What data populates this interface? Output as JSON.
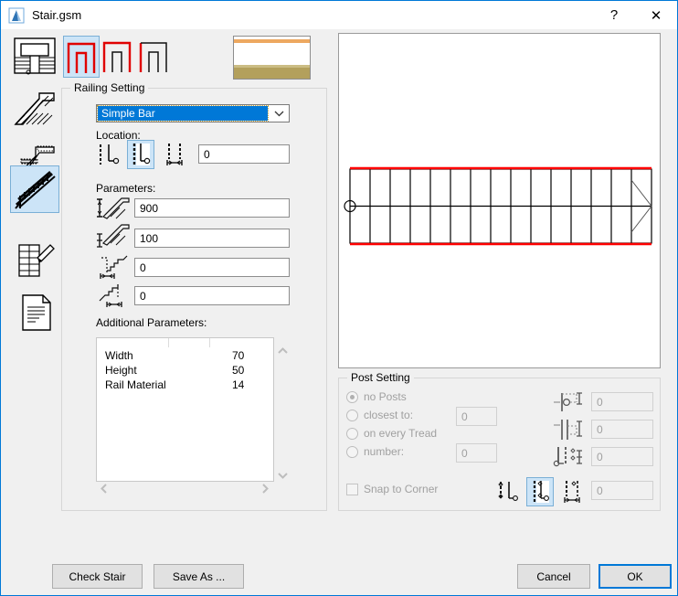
{
  "window": {
    "title": "Stair.gsm",
    "help_label": "?",
    "close_label": "✕"
  },
  "sidebar": {
    "items": [
      {
        "name": "stair-plan",
        "selected": false
      },
      {
        "name": "stair-section",
        "selected": false
      },
      {
        "name": "stair-structure",
        "selected": false
      },
      {
        "name": "stair-railing",
        "selected": true
      },
      {
        "name": "stair-symbol",
        "selected": false
      },
      {
        "name": "stair-listing",
        "selected": false
      }
    ]
  },
  "toolbar": {
    "shapes": [
      {
        "name": "railing-both-sides",
        "selected": true
      },
      {
        "name": "railing-left-side",
        "selected": false
      },
      {
        "name": "railing-right-side",
        "selected": false
      }
    ]
  },
  "railing_setting": {
    "group_title": "Railing Setting",
    "type_value": "Simple Bar",
    "location_label": "Location:",
    "location_buttons": [
      {
        "name": "location-outer",
        "selected": false
      },
      {
        "name": "location-inner",
        "selected": true
      },
      {
        "name": "location-offset",
        "selected": false
      }
    ],
    "location_value": "0",
    "parameters_label": "Parameters:",
    "parameters": [
      {
        "icon": "railing-height-icon",
        "value": "900"
      },
      {
        "icon": "railing-rail-height-icon",
        "value": "100"
      },
      {
        "icon": "railing-start-offset-icon",
        "value": "0"
      },
      {
        "icon": "railing-end-offset-icon",
        "value": "0"
      }
    ],
    "additional_label": "Additional Parameters:",
    "additional_rows": [
      {
        "name": "Width",
        "value": "70"
      },
      {
        "name": "Height",
        "value": "50"
      },
      {
        "name": "Rail Material",
        "value": "14"
      }
    ],
    "scroll_up": "⌃",
    "scroll_down": "⌄",
    "scroll_left": "‹",
    "scroll_right": "›"
  },
  "post_setting": {
    "group_title": "Post Setting",
    "radios": [
      {
        "label": "no Posts",
        "selected": true,
        "has_field": false,
        "value": ""
      },
      {
        "label": "closest to:",
        "selected": false,
        "has_field": true,
        "value": "0"
      },
      {
        "label": "on every Tread",
        "selected": false,
        "has_field": false,
        "value": ""
      },
      {
        "label": "number:",
        "selected": false,
        "has_field": true,
        "value": "0"
      }
    ],
    "snap_label": "Snap to Corner",
    "snap_checked": false,
    "right_fields": [
      {
        "icon": "post-width-icon",
        "value": "0"
      },
      {
        "icon": "post-height-icon",
        "value": "0"
      },
      {
        "icon": "post-spacing-icon",
        "value": "0"
      }
    ],
    "align_buttons": [
      {
        "name": "post-align-outer",
        "selected": false
      },
      {
        "name": "post-align-center",
        "selected": true
      },
      {
        "name": "post-align-offset",
        "selected": false
      }
    ],
    "align_value": "0"
  },
  "preview": {
    "tread_count": 15,
    "railing_color": "#ff0000",
    "line_color": "#000000"
  },
  "footer": {
    "check_stair": "Check Stair",
    "save_as": "Save As ...",
    "cancel": "Cancel",
    "ok": "OK"
  }
}
